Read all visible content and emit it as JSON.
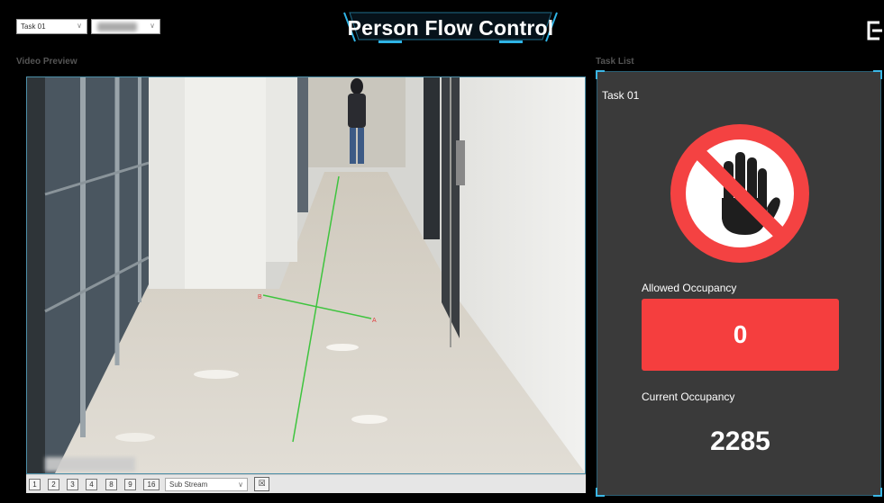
{
  "header": {
    "title": "Person Flow Control",
    "task_select": {
      "value": "Task 01"
    },
    "channel_select": {
      "value": ""
    }
  },
  "video_preview": {
    "label": "Video Preview",
    "toolbar": {
      "layouts": [
        "1",
        "2",
        "3",
        "4",
        "8",
        "9",
        "16"
      ],
      "stream": "Sub Stream",
      "snapshot_icon": "close-window-icon"
    },
    "line_markers": {
      "a": "A",
      "b": "B"
    }
  },
  "task_list": {
    "label": "Task List",
    "task": {
      "name": "Task 01",
      "status_icon": "no-entry-hand-icon",
      "allowed_occupancy_label": "Allowed Occupancy",
      "allowed_occupancy": "0",
      "current_occupancy_label": "Current Occupancy",
      "current_occupancy": "2285"
    }
  },
  "colors": {
    "accent": "#3bb7e6",
    "alert": "#f53e3e",
    "panel": "#3a3a3a"
  }
}
